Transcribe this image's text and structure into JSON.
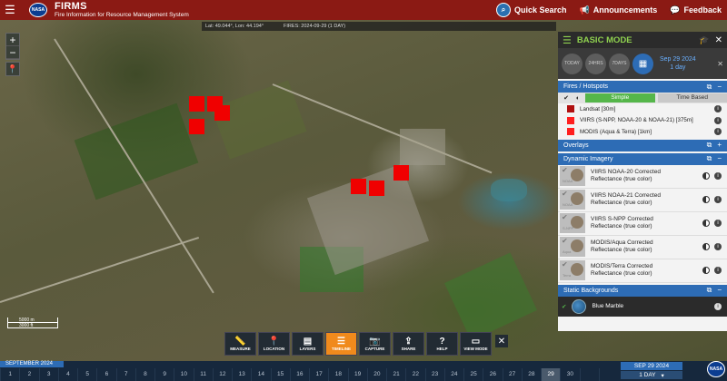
{
  "header": {
    "menu_icon": "hamburger-icon",
    "logo_text": "NASA",
    "title": "FIRMS",
    "subtitle": "Fire Information for Resource Management System",
    "quick_search": "Quick Search",
    "announcements": "Announcements",
    "feedback": "Feedback"
  },
  "map": {
    "coords": "Lat: 49.044°, Lon: 44.194°",
    "fires_label": "FIRES: 2024-09-29 (1 DAY)",
    "zoom_in": "+",
    "zoom_out": "−",
    "scale_a": "5000 m",
    "scale_b": "3000 ft"
  },
  "toolbar": {
    "tools": [
      {
        "label": "MEASURE",
        "icon": "ruler-icon",
        "glyph": "📏"
      },
      {
        "label": "LOCATION",
        "icon": "map-pin-icon",
        "glyph": "📍"
      },
      {
        "label": "LAYERS",
        "icon": "layers-icon",
        "glyph": "▤"
      },
      {
        "label": "TIMELINE",
        "icon": "timeline-icon",
        "glyph": "☰"
      },
      {
        "label": "CAPTURE",
        "icon": "camera-icon",
        "glyph": "📷"
      },
      {
        "label": "SHARE",
        "icon": "share-icon",
        "glyph": "⇪"
      },
      {
        "label": "HELP",
        "icon": "help-icon",
        "glyph": "?"
      },
      {
        "label": "VIEW MODE",
        "icon": "monitor-icon",
        "glyph": "▭"
      }
    ],
    "close": "✕"
  },
  "timeline": {
    "month": "SEPTEMBER 2024",
    "days": [
      "1",
      "2",
      "3",
      "4",
      "5",
      "6",
      "7",
      "8",
      "9",
      "10",
      "11",
      "12",
      "13",
      "14",
      "15",
      "16",
      "17",
      "18",
      "19",
      "20",
      "21",
      "22",
      "23",
      "24",
      "25",
      "26",
      "27",
      "28",
      "29",
      "30",
      "",
      ""
    ],
    "selected_day": "29",
    "current_date": "SEP 29 2024",
    "range": "1 DAY"
  },
  "panel": {
    "mode_title": "BASIC MODE",
    "time_buttons": [
      "TODAY",
      "24HRS",
      "7DAYS"
    ],
    "date": "Sep 29 2024",
    "range": "1 day",
    "fires_section": "Fires / Hotspots",
    "tab_simple": "Simple",
    "tab_time": "Time Based",
    "fire_layers": [
      {
        "name": "Landsat [30m]",
        "color": "#b01010"
      },
      {
        "name": "VIIRS (S-NPP, NOAA-20 & NOAA-21) [375m]",
        "color": "#ff1f1f"
      },
      {
        "name": "MODIS (Aqua & Terra) [1km]",
        "color": "#ff1f1f"
      }
    ],
    "overlays_section": "Overlays",
    "dynamic_section": "Dynamic Imagery",
    "dynamic_layers": [
      {
        "line1": "VIIRS NOAA-20 Corrected",
        "line2": "Reflectance (true color)",
        "thumb": "NOAA"
      },
      {
        "line1": "VIIRS NOAA-21 Corrected",
        "line2": "Reflectance (true color)",
        "thumb": "NOAA"
      },
      {
        "line1": "VIIRS S-NPP Corrected",
        "line2": "Reflectance (true color)",
        "thumb": "S-NPP"
      },
      {
        "line1": "MODIS/Aqua Corrected",
        "line2": "Reflectance (true color)",
        "thumb": "Aqua"
      },
      {
        "line1": "MODIS/Terra Corrected",
        "line2": "Reflectance (true color)",
        "thumb": "Terra"
      }
    ],
    "static_section": "Static Backgrounds",
    "static_layer": "Blue Marble"
  },
  "colors": {
    "header_bg": "#8b1a14",
    "panel_section": "#2d6cb5",
    "fire_red": "#f00000",
    "mode_green": "#8fd14f",
    "active_tool": "#f08a1c"
  }
}
